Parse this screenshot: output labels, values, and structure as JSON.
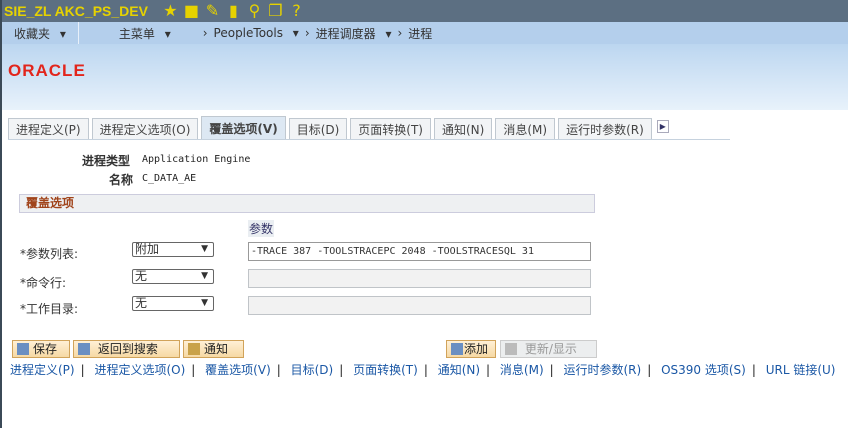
{
  "header": {
    "system": "SIE_ZL AKC_PS_DEV",
    "icons": [
      "star-icon",
      "folder-icon",
      "pencil-icon",
      "document-icon",
      "search-icon",
      "pages-icon",
      "help-icon"
    ]
  },
  "nav": {
    "favorites": "收藏夹",
    "main_menu": "主菜单",
    "crumbs": [
      "PeopleTools",
      "进程调度器",
      "进程"
    ]
  },
  "brand": "ORACLE",
  "tabs": [
    "进程定义(P)",
    "进程定义选项(O)",
    "覆盖选项(V)",
    "目标(D)",
    "页面转换(T)",
    "通知(N)",
    "消息(M)",
    "运行时参数(R)"
  ],
  "active_tab": 2,
  "info": {
    "type_label": "进程类型",
    "type_value": "Application Engine",
    "name_label": "名称",
    "name_value": "C_DATA_AE"
  },
  "section": {
    "title": "覆盖选项",
    "param_header": "参数"
  },
  "fields": [
    {
      "label": "*参数列表:",
      "select": "附加",
      "value": "-TRACE 387 -TOOLSTRACEPC 2048 -TOOLSTRACESQL 31"
    },
    {
      "label": "*命令行:",
      "select": "无",
      "value": ""
    },
    {
      "label": "*工作目录:",
      "select": "无",
      "value": ""
    }
  ],
  "buttons": {
    "save": "保存",
    "return": "返回到搜索",
    "notify": "通知",
    "add": "添加",
    "update": "更新/显示"
  },
  "links": [
    "进程定义(P)",
    "进程定义选项(O)",
    "覆盖选项(V)",
    "目标(D)",
    "页面转换(T)",
    "通知(N)",
    "消息(M)",
    "运行时参数(R)",
    "OS390 选项(S)",
    "URL 链接(U)"
  ]
}
